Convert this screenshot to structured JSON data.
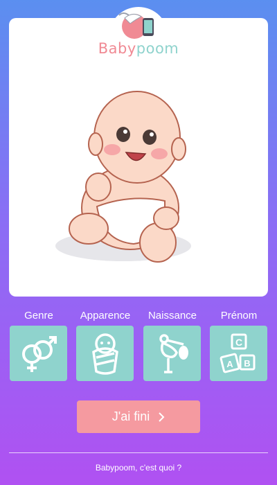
{
  "brand": {
    "name_part1": "Baby",
    "name_part2": "poom"
  },
  "categories": [
    {
      "label": "Genre",
      "icon": "gender-icon"
    },
    {
      "label": "Apparence",
      "icon": "swaddled-baby-icon"
    },
    {
      "label": "Naissance",
      "icon": "stork-icon"
    },
    {
      "label": "Prénom",
      "icon": "abc-blocks-icon"
    }
  ],
  "actions": {
    "done_label": "J'ai fini"
  },
  "footer": {
    "about_link": "Babypoom, c'est quoi ?"
  },
  "colors": {
    "accent_teal": "#8fd3cd",
    "accent_pink": "#f59aa0",
    "gradient_top": "#5b8ff0",
    "gradient_bottom": "#b051f2"
  }
}
